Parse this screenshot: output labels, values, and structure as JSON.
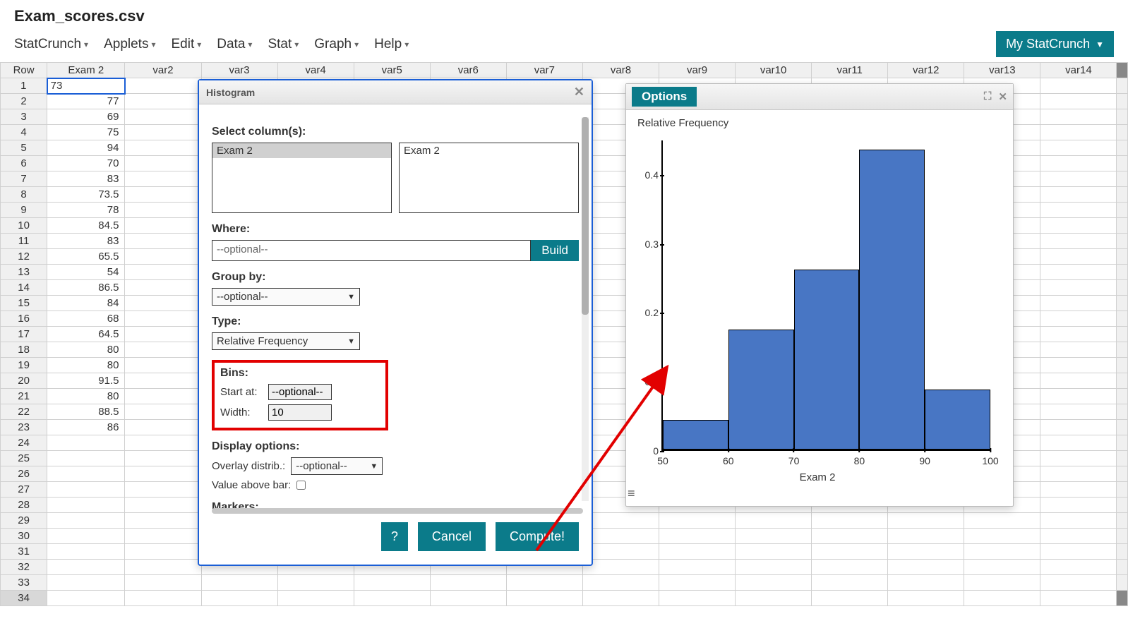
{
  "filename": "Exam_scores.csv",
  "menus": [
    "StatCrunch",
    "Applets",
    "Edit",
    "Data",
    "Stat",
    "Graph",
    "Help"
  ],
  "mystatcrunch": "My StatCrunch",
  "columns": [
    "Row",
    "Exam 2",
    "var2",
    "var3",
    "var4",
    "var5",
    "var6",
    "var7",
    "var8",
    "var9",
    "var10",
    "var11",
    "var12",
    "var13",
    "var14"
  ],
  "data_rows": [
    {
      "row": "1",
      "val": "73"
    },
    {
      "row": "2",
      "val": "77"
    },
    {
      "row": "3",
      "val": "69"
    },
    {
      "row": "4",
      "val": "75"
    },
    {
      "row": "5",
      "val": "94"
    },
    {
      "row": "6",
      "val": "70"
    },
    {
      "row": "7",
      "val": "83"
    },
    {
      "row": "8",
      "val": "73.5"
    },
    {
      "row": "9",
      "val": "78"
    },
    {
      "row": "10",
      "val": "84.5"
    },
    {
      "row": "11",
      "val": "83"
    },
    {
      "row": "12",
      "val": "65.5"
    },
    {
      "row": "13",
      "val": "54"
    },
    {
      "row": "14",
      "val": "86.5"
    },
    {
      "row": "15",
      "val": "84"
    },
    {
      "row": "16",
      "val": "68"
    },
    {
      "row": "17",
      "val": "64.5"
    },
    {
      "row": "18",
      "val": "80"
    },
    {
      "row": "19",
      "val": "80"
    },
    {
      "row": "20",
      "val": "91.5"
    },
    {
      "row": "21",
      "val": "80"
    },
    {
      "row": "22",
      "val": "88.5"
    },
    {
      "row": "23",
      "val": "86"
    },
    {
      "row": "24",
      "val": ""
    },
    {
      "row": "25",
      "val": ""
    },
    {
      "row": "26",
      "val": ""
    },
    {
      "row": "27",
      "val": ""
    },
    {
      "row": "28",
      "val": ""
    },
    {
      "row": "29",
      "val": ""
    },
    {
      "row": "30",
      "val": ""
    },
    {
      "row": "31",
      "val": ""
    },
    {
      "row": "32",
      "val": ""
    },
    {
      "row": "33",
      "val": ""
    },
    {
      "row": "34",
      "val": ""
    }
  ],
  "hist_dialog": {
    "title": "Histogram",
    "select_cols_label": "Select column(s):",
    "available": "Exam 2",
    "selected": "Exam 2",
    "where_label": "Where:",
    "where_value": "--optional--",
    "build": "Build",
    "groupby_label": "Group by:",
    "groupby_value": "--optional--",
    "type_label": "Type:",
    "type_value": "Relative Frequency",
    "bins_label": "Bins:",
    "start_label": "Start at:",
    "start_value": "--optional--",
    "width_label": "Width:",
    "width_value": "10",
    "display_label": "Display options:",
    "overlay_label": "Overlay distrib.:",
    "overlay_value": "--optional--",
    "value_above_label": "Value above bar:",
    "markers_label": "Markers:",
    "help": "?",
    "cancel": "Cancel",
    "compute": "Compute!"
  },
  "chart_dialog": {
    "options": "Options",
    "ylabel": "Relative Frequency",
    "xlabel": "Exam 2"
  },
  "chart_data": {
    "type": "bar",
    "title": "Relative Frequency",
    "xlabel": "Exam 2",
    "ylabel": "Relative Frequency",
    "x_ticks": [
      50,
      60,
      70,
      80,
      90,
      100
    ],
    "y_ticks": [
      0,
      0.1,
      0.2,
      0.3,
      0.4
    ],
    "ylim": [
      0,
      0.45
    ],
    "xlim": [
      50,
      100
    ],
    "bin_edges": [
      50,
      60,
      70,
      80,
      90,
      100
    ],
    "values": [
      0.043,
      0.174,
      0.261,
      0.435,
      0.087
    ]
  }
}
